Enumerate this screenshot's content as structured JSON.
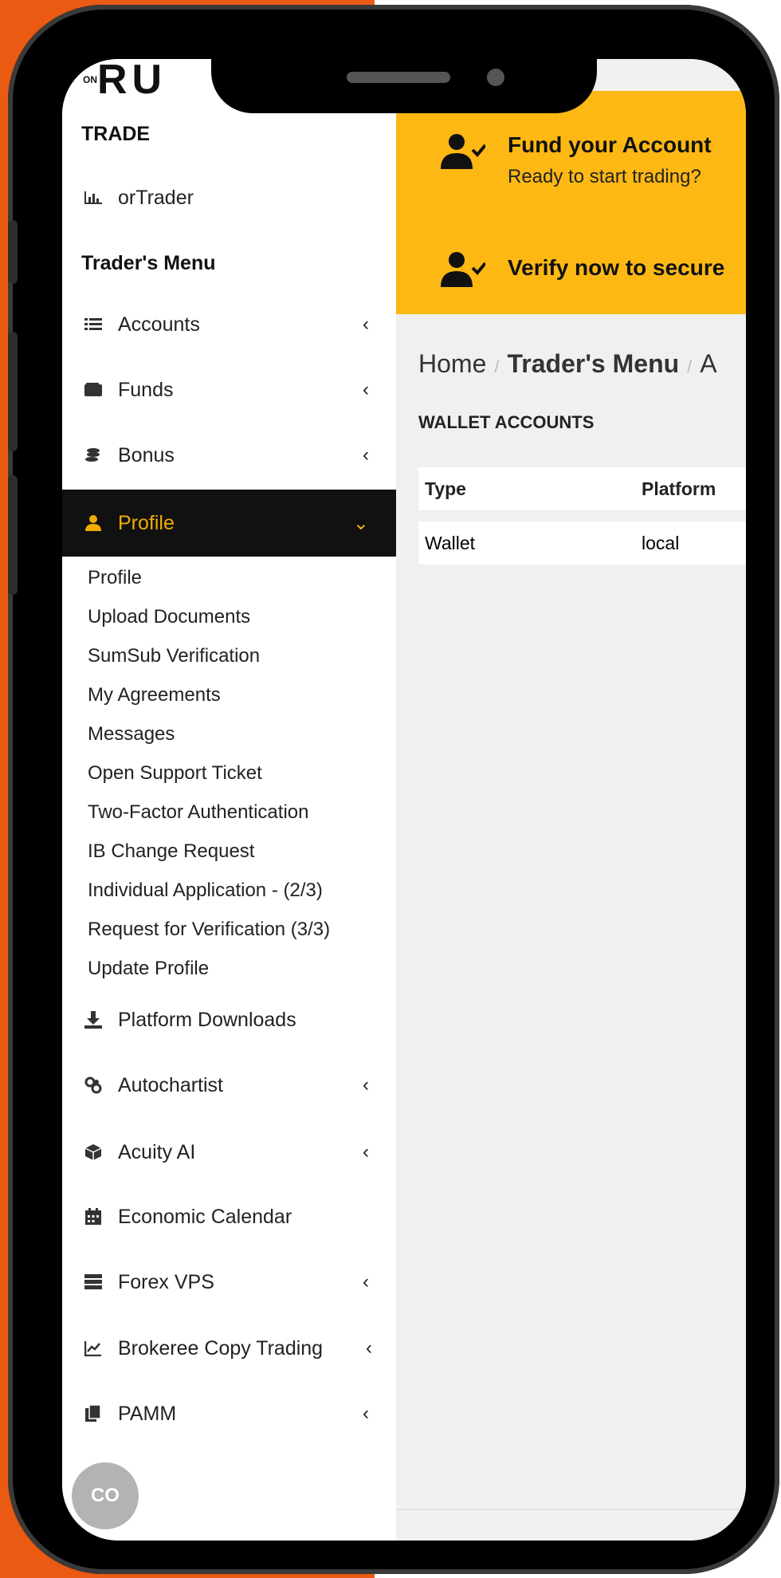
{
  "brand": {
    "logo_text": "RU",
    "logo_small": "ON"
  },
  "sidebar": {
    "trade_heading": "TRADE",
    "trade_item": {
      "label": "orTrader",
      "icon": "bar-chart-icon"
    },
    "menu_heading": "Trader's Menu",
    "items": [
      {
        "label": "Accounts",
        "icon": "list-icon",
        "chevron": "‹"
      },
      {
        "label": "Funds",
        "icon": "wallet-icon",
        "chevron": "‹"
      },
      {
        "label": "Bonus",
        "icon": "coins-icon",
        "chevron": "‹"
      },
      {
        "label": "Profile",
        "icon": "user-icon",
        "chevron": "⌄",
        "active": true
      }
    ],
    "profile_submenu": [
      "Profile",
      "Upload Documents",
      "SumSub Verification",
      "My Agreements",
      "Messages",
      "Open Support Ticket",
      "Two-Factor Authentication",
      "IB Change Request",
      "Individual Application - (2/3)",
      "Request for Verification (3/3)",
      "Update Profile"
    ],
    "lower_items": [
      {
        "label": "Platform Downloads",
        "icon": "download-icon",
        "chevron": ""
      },
      {
        "label": "Autochartist",
        "icon": "chart-pattern-icon",
        "chevron": "‹"
      },
      {
        "label": "Acuity AI",
        "icon": "cube-icon",
        "chevron": "‹"
      },
      {
        "label": "Economic Calendar",
        "icon": "calendar-icon",
        "chevron": ""
      },
      {
        "label": "Forex VPS",
        "icon": "server-icon",
        "chevron": "‹"
      },
      {
        "label": "Brokeree Copy Trading",
        "icon": "line-chart-icon",
        "chevron": "‹"
      },
      {
        "label": "PAMM",
        "icon": "copy-icon",
        "chevron": "‹"
      }
    ],
    "chat_label": "CO"
  },
  "banner": {
    "fund_title": "Fund your Account",
    "fund_sub": "Ready to start trading?",
    "verify_title": "Verify now to secure",
    "bg_color": "#fdb813"
  },
  "breadcrumb": {
    "home": "Home",
    "menu": "Trader's Menu",
    "current": "A"
  },
  "wallet": {
    "title": "WALLET ACCOUNTS",
    "columns": [
      "Type",
      "Platform"
    ],
    "rows": [
      [
        "Wallet",
        "local"
      ]
    ]
  },
  "colors": {
    "accent": "#f0ad00",
    "background_left": "#ea5a12"
  }
}
